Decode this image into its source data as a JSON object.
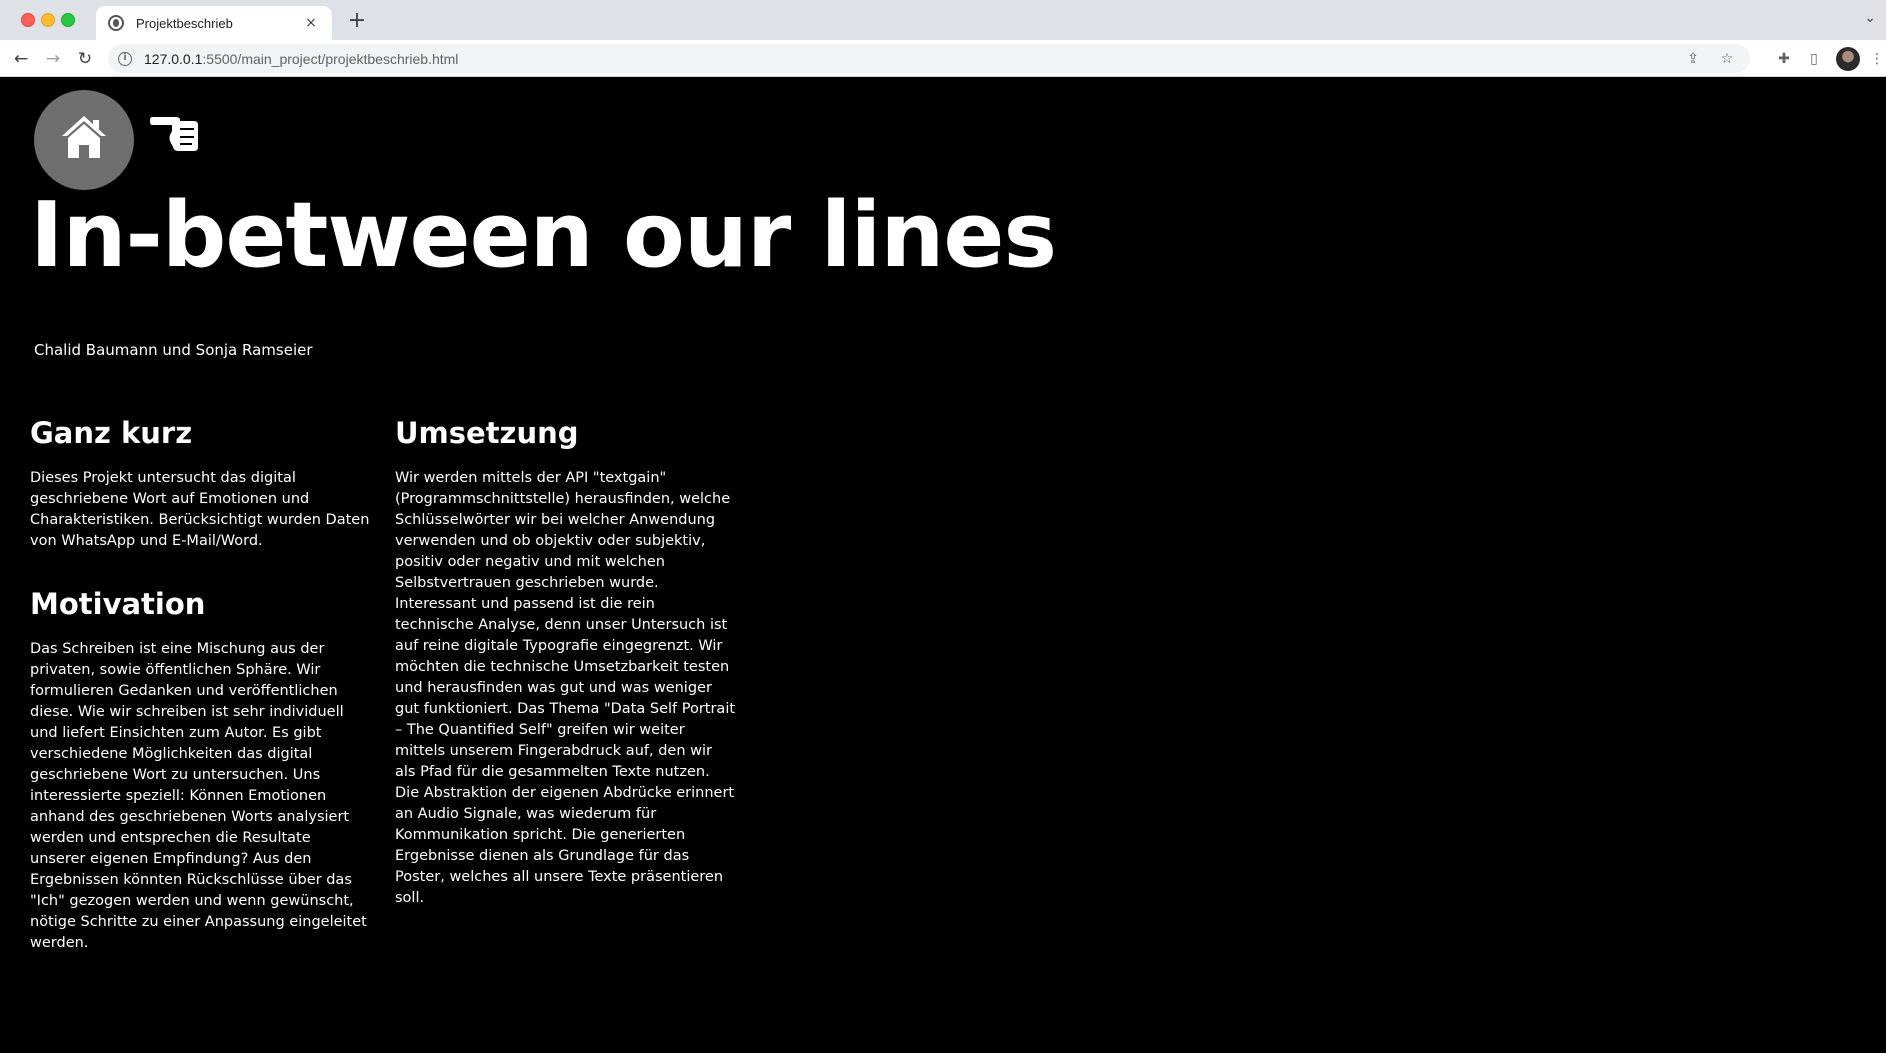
{
  "browser": {
    "tab_title": "Projektbeschrieb",
    "tab_close": "×",
    "new_tab": "+",
    "url_host": "127.0.0.1",
    "url_rest": ":5500/main_project/projektbeschrieb.html"
  },
  "page": {
    "title": "In-between our lines",
    "authors": "Chalid Baumann und Sonja Ramseier",
    "sections": [
      {
        "heading": "Ganz kurz",
        "text": "Dieses Projekt untersucht das digital geschriebene Wort auf Emotionen und Charakteristiken. Berücksichtigt wurden Daten von WhatsApp und E-Mail/Word."
      },
      {
        "heading": "Motivation",
        "text": "Das Schreiben ist eine Mischung aus der privaten, sowie öffentlichen Sphäre. Wir formulieren Gedanken und veröffentlichen diese. Wie wir schreiben ist sehr individuell und liefert Einsichten zum Autor. Es gibt verschiedene Möglichkeiten das digital geschriebene Wort zu untersuchen. Uns interessierte speziell: Können Emotionen anhand des geschriebenen Worts analysiert werden und entsprechen die Resultate unserer eigenen Empfindung? Aus den Ergebnissen könnten Rückschlüsse über das \"Ich\" gezogen werden und wenn gewünscht, nötige Schritte zu einer Anpassung eingeleitet werden."
      },
      {
        "heading": "Umsetzung",
        "text": "Wir werden mittels der API \"textgain\" (Programmschnittstelle) herausfinden, welche Schlüsselwörter wir bei welcher Anwendung verwenden und ob objektiv oder subjektiv, positiv oder negativ und mit welchen Selbstvertrauen geschrieben wurde. Interessant und passend ist die rein technische Analyse, denn unser Untersuch ist auf reine digitale Typografie eingegrenzt. Wir möchten die technische Umsetzbarkeit testen und herausfinden was gut und was weniger gut funktioniert. Das Thema \"Data Self Portrait – The Quantified Self\" greifen wir weiter mittels unserem Fingerabdruck auf, den wir als Pfad für die gesammelten Texte nutzen. Die Abstraktion der eigenen Abdrücke erinnert an Audio Signale, was wiederum für Kommunikation spricht. Die generierten Ergebnisse dienen als Grundlage für das Poster, welches all unsere Texte präsentieren soll."
      }
    ]
  },
  "icons": {
    "home": "home-icon",
    "pointer": "pointing-hand-icon"
  },
  "colors": {
    "page_background": "#000000",
    "text": "#ffffff",
    "home_button": "#6e6e6e"
  }
}
